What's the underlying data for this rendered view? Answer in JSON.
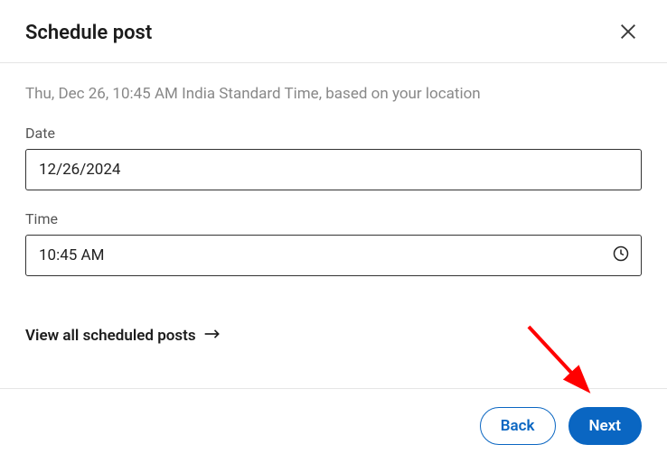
{
  "modal": {
    "title": "Schedule post",
    "schedule_info": "Thu, Dec 26, 10:45 AM India Standard Time, based on your location",
    "date_label": "Date",
    "date_value": "12/26/2024",
    "time_label": "Time",
    "time_value": "10:45 AM",
    "view_all_label": "View all scheduled posts",
    "back_label": "Back",
    "next_label": "Next"
  }
}
